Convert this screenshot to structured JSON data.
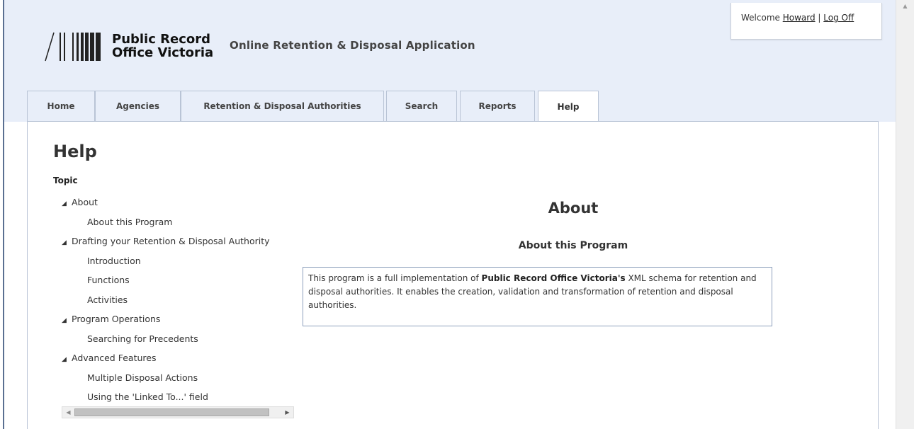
{
  "header": {
    "logo_line1": "Public Record",
    "logo_line2": "Office Victoria",
    "app_title": "Online Retention & Disposal Application"
  },
  "user": {
    "welcome": "Welcome",
    "name": "Howard",
    "separator": "|",
    "logoff": "Log Off"
  },
  "tabs": [
    {
      "label": "Home",
      "active": false
    },
    {
      "label": "Agencies",
      "active": false
    },
    {
      "label": "Retention & Disposal Authorities",
      "active": false
    },
    {
      "label": "Search",
      "active": false
    },
    {
      "label": "Reports",
      "active": false
    },
    {
      "label": "Help",
      "active": true
    }
  ],
  "page": {
    "title": "Help",
    "topic_label": "Topic"
  },
  "tree": [
    {
      "label": "About",
      "level": 0
    },
    {
      "label": "About this Program",
      "level": 1
    },
    {
      "label": "Drafting your Retention & Disposal Authority",
      "level": 0
    },
    {
      "label": "Introduction",
      "level": 1
    },
    {
      "label": "Functions",
      "level": 1
    },
    {
      "label": "Activities",
      "level": 1
    },
    {
      "label": "Program Operations",
      "level": 0
    },
    {
      "label": "Searching for Precedents",
      "level": 1
    },
    {
      "label": "Advanced Features",
      "level": 0
    },
    {
      "label": "Multiple Disposal Actions",
      "level": 1
    },
    {
      "label": "Using the 'Linked To...' field",
      "level": 1
    }
  ],
  "content": {
    "section_title": "About",
    "subsection_title": "About this Program",
    "desc_part1": "This program is a full implementation of ",
    "desc_bold1": "Public Record Office Victoria's",
    "desc_part2": " XML schema for retention and disposal authorities. It enables the creation, validation and transformation of retention and disposal authorities."
  },
  "icons": {
    "tree_expanded": "triangle-down-right-icon",
    "scroll_left": "arrow-left-icon",
    "scroll_right": "arrow-right-icon",
    "scroll_up": "arrow-up-icon"
  },
  "colors": {
    "header_bg": "#e8eef9",
    "border": "#b9c4d6",
    "frame": "#5a6f91"
  }
}
